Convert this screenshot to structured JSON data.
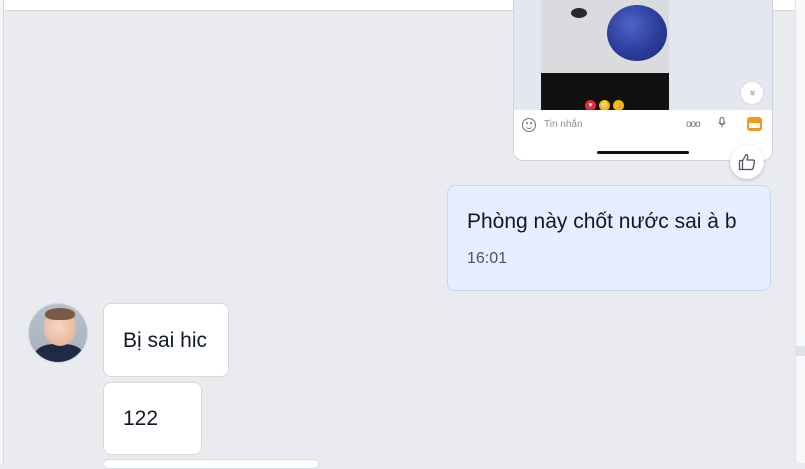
{
  "screenshot_card": {
    "input_placeholder": "Tin nhắn",
    "more_glyph": "ooo",
    "scroll_down_glyph": "»",
    "reactions": [
      {
        "glyph": "♥",
        "color": "#e02a3b"
      },
      {
        "glyph": "😆",
        "color": "#f5b400"
      },
      {
        "glyph": "👍",
        "color": "#f5b400"
      }
    ],
    "share_glyph": "➦",
    "accent_color": "#f39a1d"
  },
  "messages": {
    "sent": [
      {
        "text": "Phòng này chốt nước sai à b",
        "time": "16:01"
      }
    ],
    "received": [
      {
        "text": "Bị sai hic"
      },
      {
        "text": "122"
      }
    ]
  },
  "icons": {
    "like": "thumbs-up-icon",
    "emoji": "smiley-icon",
    "mic": "microphone-icon",
    "image": "image-icon"
  },
  "colors": {
    "chat_background": "#e9ebef",
    "sent_bubble": "#e5efff",
    "received_bubble": "#ffffff"
  }
}
